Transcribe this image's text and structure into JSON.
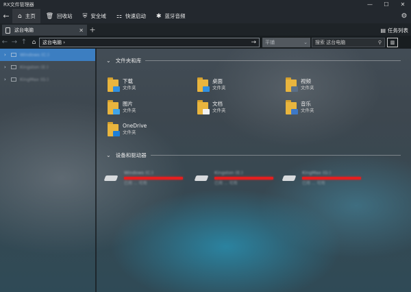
{
  "app": {
    "title": "RX文件管理器"
  },
  "window_controls": {
    "minimize": "—",
    "maximize": "☐",
    "close": "✕"
  },
  "toolbar": {
    "back": "←",
    "items": [
      {
        "label": "主页",
        "icon": "home-icon",
        "glyph": "⌂"
      },
      {
        "label": "回收站",
        "icon": "recycle-bin-icon",
        "glyph": "🗑"
      },
      {
        "label": "安全域",
        "icon": "shield-icon",
        "glyph": "⛨"
      },
      {
        "label": "快速启动",
        "icon": "quick-launch-icon",
        "glyph": "⚏"
      },
      {
        "label": "蓝牙音频",
        "icon": "bluetooth-icon",
        "glyph": "✱"
      }
    ],
    "settings": "⚙"
  },
  "tabs": {
    "items": [
      {
        "label": "这台电脑",
        "close": "✕"
      }
    ],
    "add": "+",
    "task_list": {
      "label": "任务列表",
      "glyph": "▤"
    }
  },
  "address_bar": {
    "path": "这台电脑 ›",
    "go": "→",
    "view_mode": "平铺",
    "view_mode_arrow": "⌄",
    "search_placeholder": "搜索 这台电脑",
    "search_glyph": "⚲",
    "nav": {
      "back": "←",
      "forward": "→",
      "up": "↑",
      "home": "⌂"
    }
  },
  "sidebar": {
    "items": [
      {
        "label": "Windows (C:)",
        "selected": true
      },
      {
        "label": "Kingston (E:)",
        "selected": false
      },
      {
        "label": "KingMax (G:)",
        "selected": false
      }
    ]
  },
  "content": {
    "folders_section": {
      "title": "文件夹和库",
      "chevron": "⌄"
    },
    "folders": [
      {
        "name": "下载",
        "type": "文件夹",
        "icon": "downloads-folder-icon",
        "overlay": "#2f8fe0"
      },
      {
        "name": "桌面",
        "type": "文件夹",
        "icon": "desktop-folder-icon",
        "overlay": "#2f8fe0"
      },
      {
        "name": "视频",
        "type": "文件夹",
        "icon": "videos-folder-icon",
        "overlay": "#5b6f86"
      },
      {
        "name": "图片",
        "type": "文件夹",
        "icon": "pictures-folder-icon",
        "overlay": "#3fa4e8"
      },
      {
        "name": "文档",
        "type": "文件夹",
        "icon": "documents-folder-icon",
        "overlay": "#f1f1f1"
      },
      {
        "name": "音乐",
        "type": "文件夹",
        "icon": "music-folder-icon",
        "overlay": "#3d78c8"
      },
      {
        "name": "OneDrive",
        "type": "文件夹",
        "icon": "onedrive-folder-icon",
        "overlay": "#1f7fd8"
      }
    ],
    "drives_section": {
      "title": "设备和驱动器",
      "chevron": "⌄"
    },
    "drives": [
      {
        "name": "Windows (C:)",
        "free": "已用 ... 可用",
        "icon": "system-drive-icon",
        "used": 0.95
      },
      {
        "name": "Kingston (E:)",
        "free": "已用 ... 可用",
        "icon": "usb-drive-icon",
        "used": 0.95
      },
      {
        "name": "KingMax (G:)",
        "free": "已用 ... 可用",
        "icon": "usb-drive-icon",
        "used": 0.95
      }
    ]
  },
  "colors": {
    "accent": "#3c84cd",
    "drive_bar": "#e31f1f",
    "folder": "#e9b53e"
  }
}
